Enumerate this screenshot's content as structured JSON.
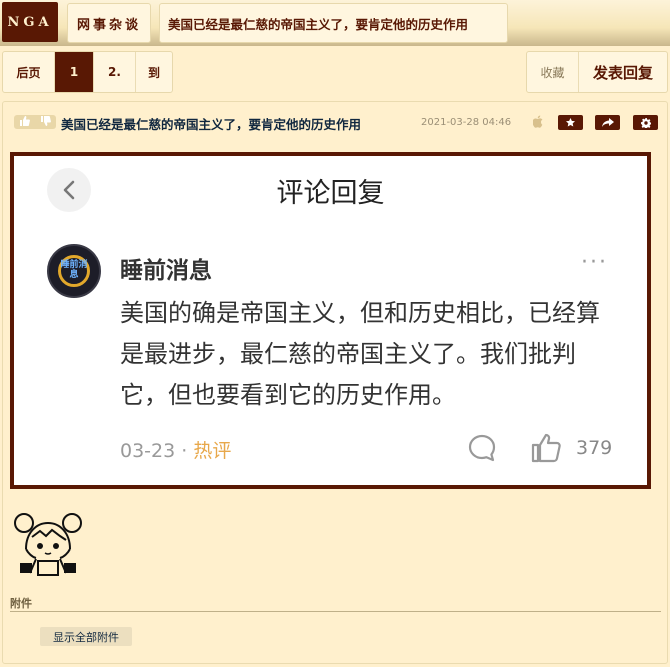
{
  "site": {
    "logo": "NGA"
  },
  "breadcrumb": {
    "forum": "网事杂谈",
    "thread_title": "美国已经是最仁慈的帝国主义了，要肯定他的历史作用"
  },
  "pager": {
    "back": "后页",
    "current": "1",
    "next": "2.",
    "goto": "到"
  },
  "actions": {
    "favorite": "收藏",
    "reply": "发表回复"
  },
  "post": {
    "title": "美国已经是最仁慈的帝国主义了，要肯定他的历史作用",
    "time": "2021-03-28 04:46",
    "icons": [
      "thumbs-up-icon",
      "thumbs-down-icon",
      "apple-icon",
      "star-icon",
      "share-icon",
      "gear-icon"
    ]
  },
  "screenshot": {
    "title": "评论回复",
    "avatar_text": "睡前消息",
    "name": "睡前消息",
    "more": "···",
    "body": "美国的确是帝国主义，但和历史相比，已经算是最进步，最仁慈的帝国主义了。我们批判它，但也要看到它的历史作用。",
    "date": "03-23",
    "separator": "·",
    "hot": "热评",
    "likes": "379"
  },
  "attachments": {
    "label": "附件",
    "show_all": "显示全部附件"
  },
  "colors": {
    "background": "#fff0cd",
    "accent": "#591804",
    "hot": "#e8a84b"
  }
}
